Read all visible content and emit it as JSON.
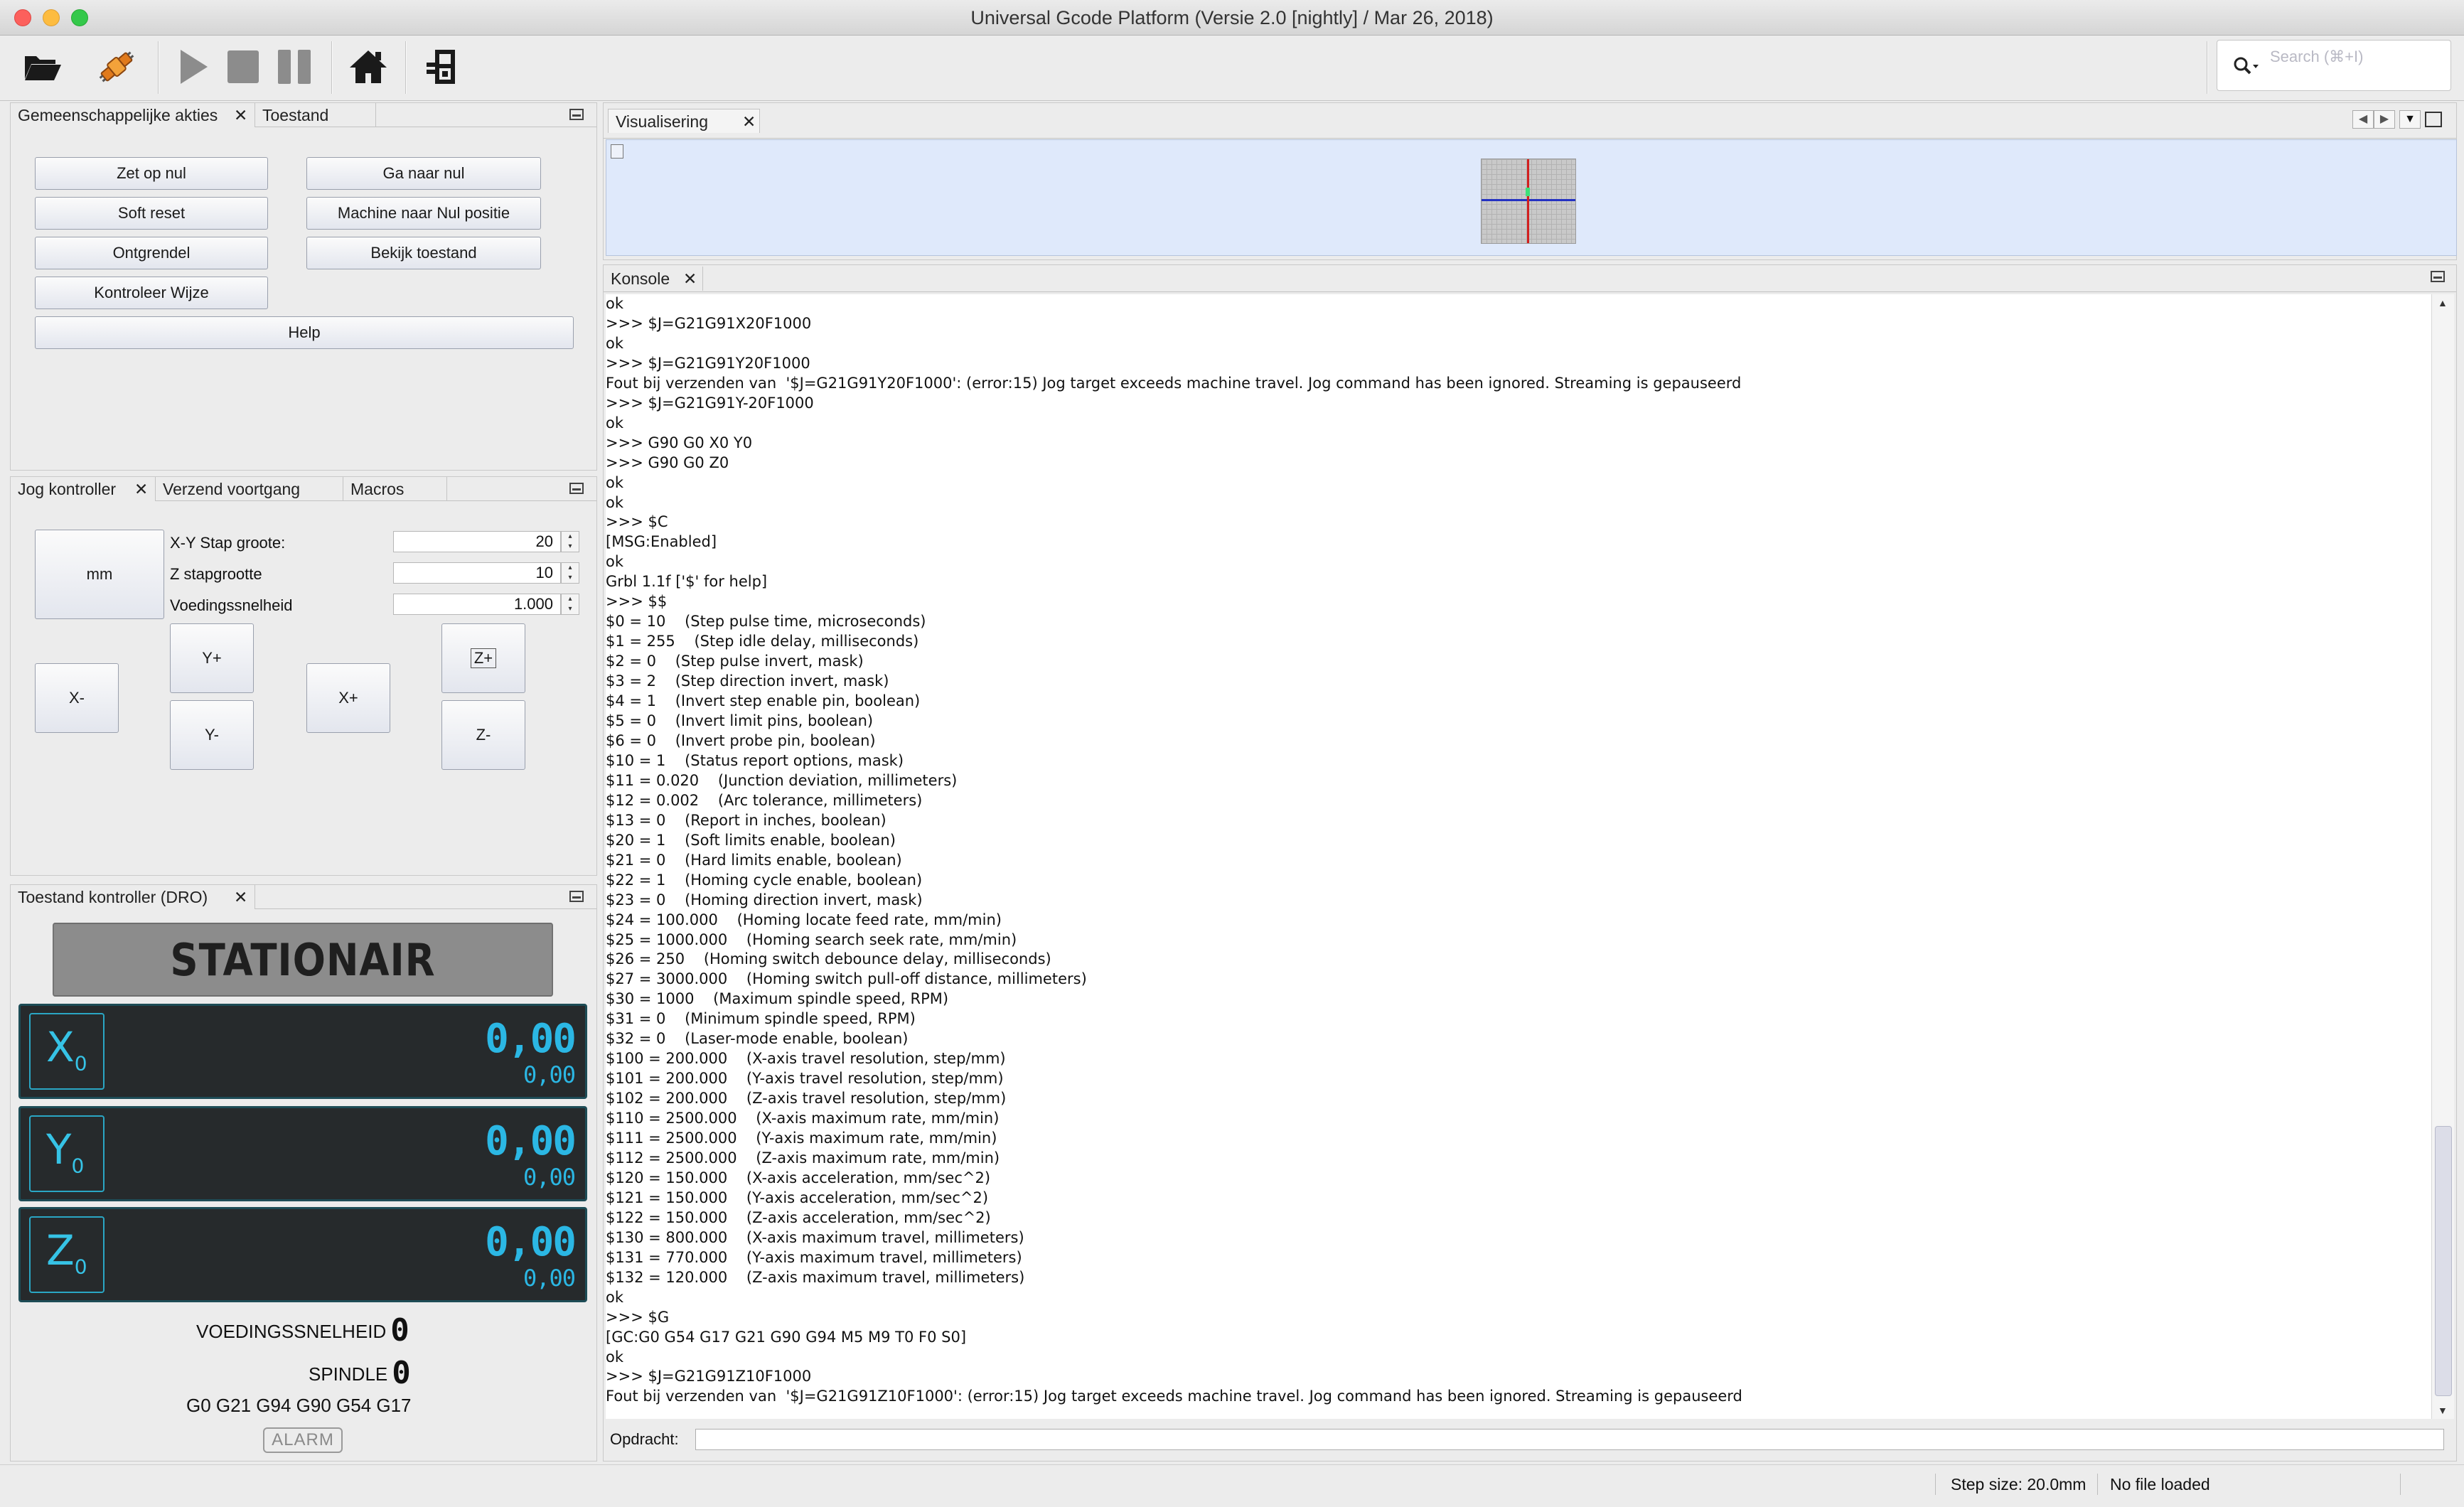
{
  "window": {
    "title": "Universal Gcode Platform (Versie 2.0 [nightly]  / Mar 26, 2018)"
  },
  "toolbar": {
    "buttons": [
      {
        "name": "open-file",
        "icon": "folder-open-icon"
      },
      {
        "name": "connect",
        "icon": "connect-plug-icon"
      },
      {
        "name": "play",
        "icon": "play-icon"
      },
      {
        "name": "stop",
        "icon": "stop-icon"
      },
      {
        "name": "pause",
        "icon": "pause-icon"
      },
      {
        "name": "home",
        "icon": "home-icon"
      },
      {
        "name": "machine",
        "icon": "machine-icon"
      }
    ],
    "search_placeholder": "Search (⌘+I)"
  },
  "actions_panel": {
    "tabs": [
      "Gemeenschappelijke akties",
      "Toestand"
    ],
    "buttons": {
      "zero": "Zet op nul",
      "goto_zero": "Ga naar nul",
      "soft_reset": "Soft reset",
      "machine_zero": "Machine naar Nul positie",
      "unlock": "Ontgrendel",
      "view_state": "Bekijk toestand",
      "check_mode": "Kontroleer Wijze",
      "help": "Help"
    }
  },
  "jog_panel": {
    "tabs": [
      "Jog kontroller",
      "Verzend voortgang",
      "Macros"
    ],
    "unit_button": "mm",
    "xy_step_label": "X-Y Stap groote:",
    "xy_step_value": "20",
    "z_step_label": "Z stapgrootte",
    "z_step_value": "10",
    "feed_label": "Voedingssnelheid",
    "feed_value": "1.000",
    "buttons": {
      "x_minus": "X-",
      "x_plus": "X+",
      "y_plus": "Y+",
      "y_minus": "Y-",
      "z_plus": "Z+",
      "z_minus": "Z-"
    }
  },
  "dro_panel": {
    "tab": "Toestand kontroller (DRO)",
    "state": "STATIONAIR",
    "axes": [
      {
        "name": "X",
        "sub": "0",
        "value": "0,00",
        "work": "0,00"
      },
      {
        "name": "Y",
        "sub": "0",
        "value": "0,00",
        "work": "0,00"
      },
      {
        "name": "Z",
        "sub": "0",
        "value": "0,00",
        "work": "0,00"
      }
    ],
    "feed_label": "VOEDINGSSNELHEID",
    "feed_value": "0",
    "spindle_label": "SPINDLE",
    "spindle_value": "0",
    "gcode_state": "G0 G21 G94 G90 G54 G17",
    "alarm": "ALARM"
  },
  "visualizer": {
    "tab": "Visualisering",
    "colors": {
      "grid": "#c9c9c9",
      "x_axis": "#2432c2",
      "y_axis": "#d21f1f",
      "tool": "#3ee07a"
    }
  },
  "console": {
    "tab": "Konsole",
    "lines": [
      "ok",
      ">>> $J=G21G91X20F1000",
      "ok",
      ">>> $J=G21G91Y20F1000",
      "Fout bij verzenden van  '$J=G21G91Y20F1000': (error:15) Jog target exceeds machine travel. Jog command has been ignored. Streaming is gepauseerd",
      ">>> $J=G21G91Y-20F1000",
      "ok",
      ">>> G90 G0 X0 Y0",
      ">>> G90 G0 Z0",
      "ok",
      "ok",
      ">>> $C",
      "[MSG:Enabled]",
      "ok",
      "Grbl 1.1f ['$' for help]",
      ">>> $$",
      "$0 = 10    (Step pulse time, microseconds)",
      "$1 = 255    (Step idle delay, milliseconds)",
      "$2 = 0    (Step pulse invert, mask)",
      "$3 = 2    (Step direction invert, mask)",
      "$4 = 1    (Invert step enable pin, boolean)",
      "$5 = 0    (Invert limit pins, boolean)",
      "$6 = 0    (Invert probe pin, boolean)",
      "$10 = 1    (Status report options, mask)",
      "$11 = 0.020    (Junction deviation, millimeters)",
      "$12 = 0.002    (Arc tolerance, millimeters)",
      "$13 = 0    (Report in inches, boolean)",
      "$20 = 1    (Soft limits enable, boolean)",
      "$21 = 0    (Hard limits enable, boolean)",
      "$22 = 1    (Homing cycle enable, boolean)",
      "$23 = 0    (Homing direction invert, mask)",
      "$24 = 100.000    (Homing locate feed rate, mm/min)",
      "$25 = 1000.000    (Homing search seek rate, mm/min)",
      "$26 = 250    (Homing switch debounce delay, milliseconds)",
      "$27 = 3000.000    (Homing switch pull-off distance, millimeters)",
      "$30 = 1000    (Maximum spindle speed, RPM)",
      "$31 = 0    (Minimum spindle speed, RPM)",
      "$32 = 0    (Laser-mode enable, boolean)",
      "$100 = 200.000    (X-axis travel resolution, step/mm)",
      "$101 = 200.000    (Y-axis travel resolution, step/mm)",
      "$102 = 200.000    (Z-axis travel resolution, step/mm)",
      "$110 = 2500.000    (X-axis maximum rate, mm/min)",
      "$111 = 2500.000    (Y-axis maximum rate, mm/min)",
      "$112 = 2500.000    (Z-axis maximum rate, mm/min)",
      "$120 = 150.000    (X-axis acceleration, mm/sec^2)",
      "$121 = 150.000    (Y-axis acceleration, mm/sec^2)",
      "$122 = 150.000    (Z-axis acceleration, mm/sec^2)",
      "$130 = 800.000    (X-axis maximum travel, millimeters)",
      "$131 = 770.000    (Y-axis maximum travel, millimeters)",
      "$132 = 120.000    (Z-axis maximum travel, millimeters)",
      "ok",
      ">>> $G",
      "[GC:G0 G54 G17 G21 G90 G94 M5 M9 T0 F0 S0]",
      "ok",
      ">>> $J=G21G91Z10F1000",
      "Fout bij verzenden van  '$J=G21G91Z10F1000': (error:15) Jog target exceeds machine travel. Jog command has been ignored. Streaming is gepauseerd"
    ],
    "command_label": "Opdracht:",
    "command_value": ""
  },
  "statusbar": {
    "step_size": "Step size: 20.0mm",
    "file": "No file loaded"
  }
}
